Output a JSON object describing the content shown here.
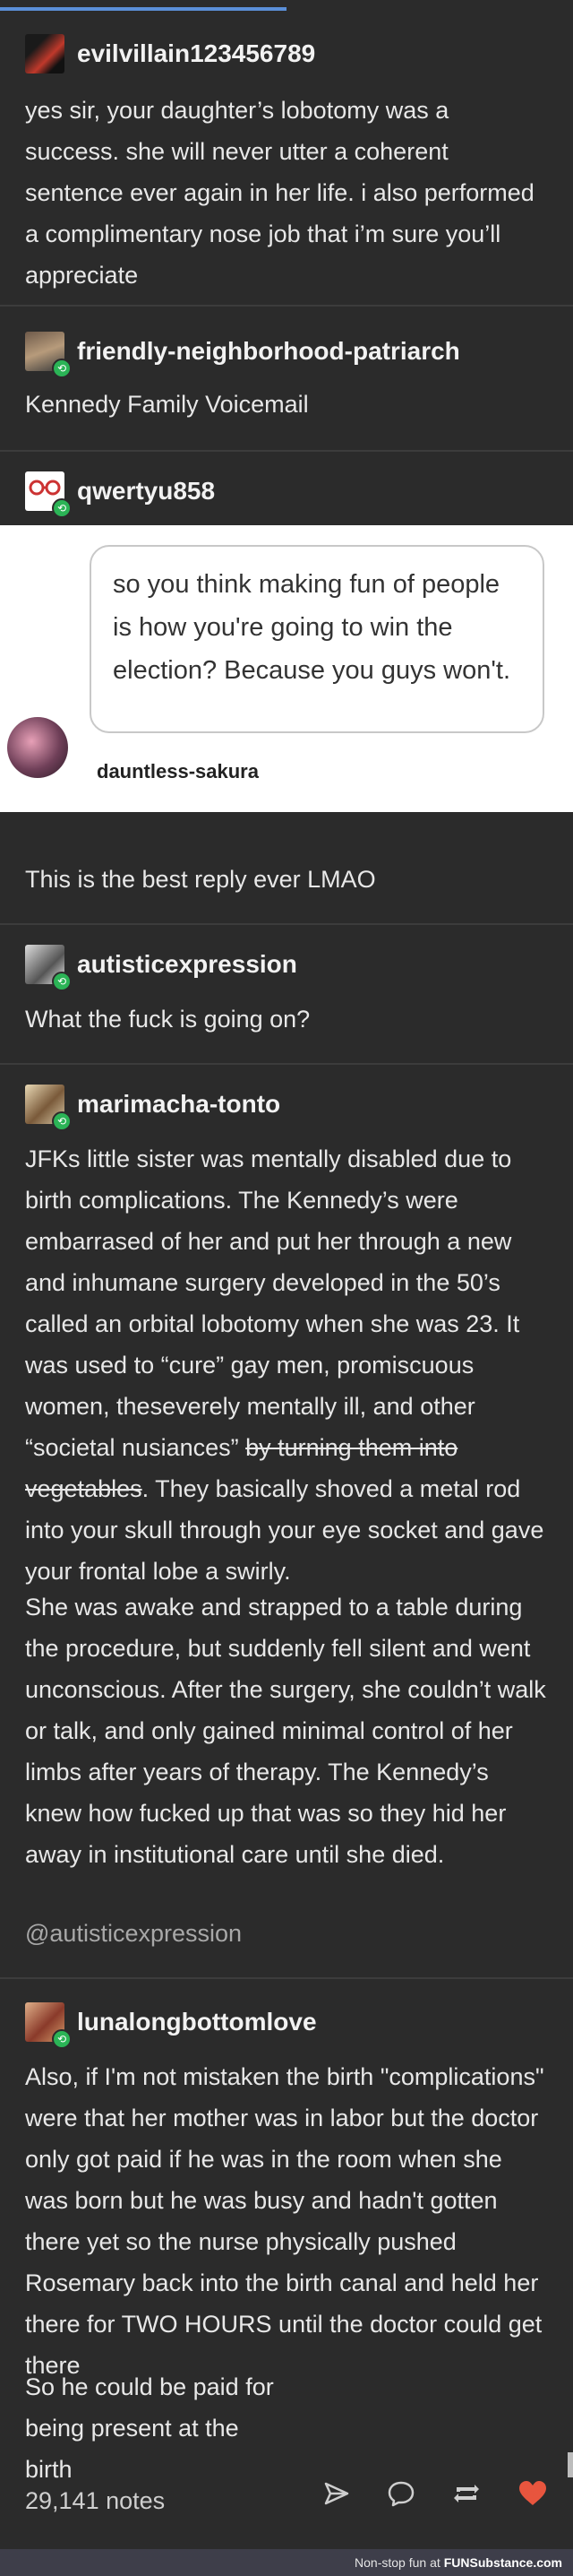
{
  "posts": [
    {
      "username": "evilvillain123456789",
      "paragraphs": [
        "yes sir, your daughter’s lobotomy was a success. she will never utter a coherent sentence ever again in her life. i also performed a complimentary nose job that i’m sure you’ll appreciate"
      ]
    },
    {
      "username": "friendly-neighborhood-patriarch",
      "paragraphs": [
        "Kennedy Family Voicemail"
      ]
    },
    {
      "username": "qwertyu858",
      "embedded": {
        "text": "so you think making fun of people is how you're going to win the election? Because you guys won't.",
        "author": "dauntless-sakura"
      },
      "paragraphs": [
        "This is the best reply ever LMAO"
      ]
    },
    {
      "username": "autisticexpression",
      "paragraphs": [
        "What the fuck is going on?"
      ]
    },
    {
      "username": "marimacha-tonto",
      "p1_before": "JFKs little sister was mentally disabled due to birth complications. The Kennedy’s were embarrased of her and put her through a new and inhumane surgery developed in the 50’s called an orbital lobotomy when she was 23. It was used to “cure” gay men, promiscuous women, theseverely mentally ill, and other “societal nusiances” ",
      "p1_strike": "by turning them into vegetables",
      "p1_after": ". They basically shoved a metal rod into your skull through your eye socket and gave your frontal lobe a swirly.",
      "p2": "She was awake and strapped to a table during the procedure, but suddenly fell silent and went unconscious. After the surgery, she couldn’t walk or talk, and only gained minimal control of her limbs after years of therapy. The Kennedy’s knew how fucked up that was so they hid her away in institutional care until she died.",
      "mention": "@autisticexpression"
    },
    {
      "username": "lunalongbottomlove",
      "p1": "Also, if I'm not mistaken the birth \"complications\" were that her mother was in labor but the doctor only got paid if he was in the room when she was born but he was busy and hadn't gotten there yet so the nurse physically pushed Rosemary back into the birth canal and held her there for TWO HOURS until the doctor could get there",
      "p2": "So he could be paid for being present at the birth"
    }
  ],
  "footer_bar": {
    "notes": "29,141 notes",
    "icons": [
      "send-icon",
      "reply-icon",
      "reblog-icon",
      "like-icon"
    ],
    "like_color": "#e8553e"
  },
  "watermark": {
    "prefix": "Non-stop fun at",
    "brand": "FUNSubstance.com"
  },
  "colors": {
    "background": "#2b2b2b",
    "reblog_badge": "#2bb456",
    "accent_bar": "#5b8fd8"
  }
}
